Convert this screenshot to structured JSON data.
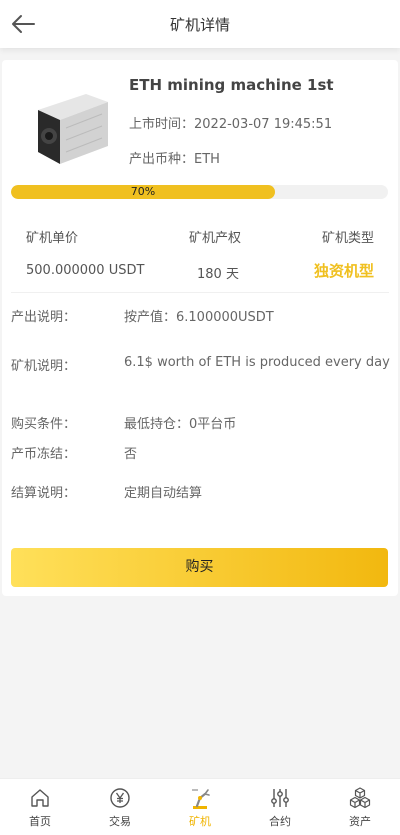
{
  "header": {
    "title": "矿机详情"
  },
  "miner": {
    "name": "ETH mining machine 1st",
    "listing_time_label": "上市时间：",
    "listing_time": "2022-03-07 19:45:51",
    "output_currency_label": "产出币种：",
    "output_currency": "ETH",
    "progress": 0.7,
    "progress_label": "70%"
  },
  "stats": {
    "price_label": "矿机单价",
    "price_value": "500.000000 USDT",
    "term_label": "矿机产权",
    "term_value": "180 天",
    "type_label": "矿机类型",
    "type_value": "独资机型"
  },
  "details": [
    {
      "label": "产出说明：",
      "value": "按产值：6.100000USDT"
    },
    {
      "label": "矿机说明：",
      "value": "6.1$ worth of ETH is produced every day"
    },
    {
      "label": "购买条件：",
      "value": "最低持仓：0平台币"
    },
    {
      "label": "产币冻结：",
      "value": "否"
    },
    {
      "label": "结算说明：",
      "value": "定期自动结算"
    }
  ],
  "buy_button": "购买",
  "tabs": [
    {
      "label": "首页",
      "icon": "home-icon"
    },
    {
      "label": "交易",
      "icon": "yen-circle-icon"
    },
    {
      "label": "矿机",
      "icon": "robot-arm-icon",
      "active": true
    },
    {
      "label": "合约",
      "icon": "sliders-icon"
    },
    {
      "label": "资产",
      "icon": "cubes-icon"
    }
  ],
  "colors": {
    "accent": "#f0c020",
    "accent_dark": "#f2b80f"
  }
}
